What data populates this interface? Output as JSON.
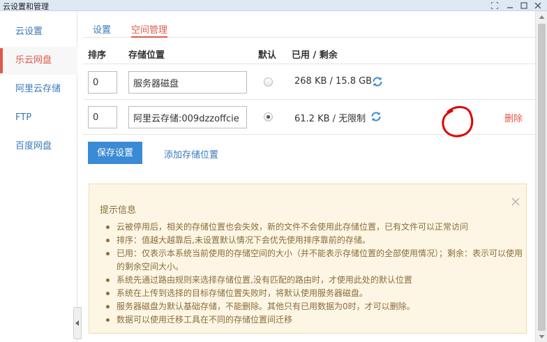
{
  "window": {
    "title": "云设置和管理"
  },
  "sidebar": {
    "items": [
      {
        "label": "云设置"
      },
      {
        "label": "乐云网盘"
      },
      {
        "label": "阿里云存储"
      },
      {
        "label": "FTP"
      },
      {
        "label": "百度网盘"
      }
    ]
  },
  "tabs": [
    {
      "label": "设置"
    },
    {
      "label": "空间管理"
    }
  ],
  "table": {
    "headers": {
      "order": "排序",
      "location": "存储位置",
      "default": "默认",
      "usage": "已用 / 剩余"
    },
    "rows": [
      {
        "order": "0",
        "location": "服务器磁盘",
        "usage": "268 KB / 15.8 GB",
        "is_default": false
      },
      {
        "order": "0",
        "location": "阿里云存储:009dzzoffcie",
        "usage": "61.2 KB / 无限制",
        "is_default": true,
        "action": "删除"
      }
    ]
  },
  "actions": {
    "save": "保存设置",
    "add_location": "添加存储位置"
  },
  "info": {
    "title": "提示信息",
    "items": [
      "云被停用后，相关的存储位置也会失效，新的文件不会使用此存储位置，已有文件可以正常访问",
      "排序：值越大越靠后,未设置默认情况下会优先使用排序靠前的存储。",
      "已用：仅表示本系统当前使用的存储空间的大小（并不能表示存储位置的全部使用情况）；剩余：表示可以使用的剩余空间大小。",
      "系统先通过路由规则来选择存储位置,没有匹配的路由时，才使用此处的默认位置",
      "系统在上传到选择的目标存储位置失败时，将默认使用服务器磁盘。",
      "服务器磁盘为默认基础存储，不能删除。其他只有已用数据为0时，才可以删除。",
      "数据可以使用迁移工具在不同的存储位置间迁移"
    ]
  },
  "icons": {
    "refresh": "refresh-icon",
    "close": "close-icon"
  },
  "colors": {
    "accent": "#e05a4a",
    "link": "#3a7ab8",
    "primary_button": "#3a8ad4",
    "info_bg": "#fdf6e4",
    "info_text": "#8a6d3b",
    "annotation": "#e00000"
  }
}
